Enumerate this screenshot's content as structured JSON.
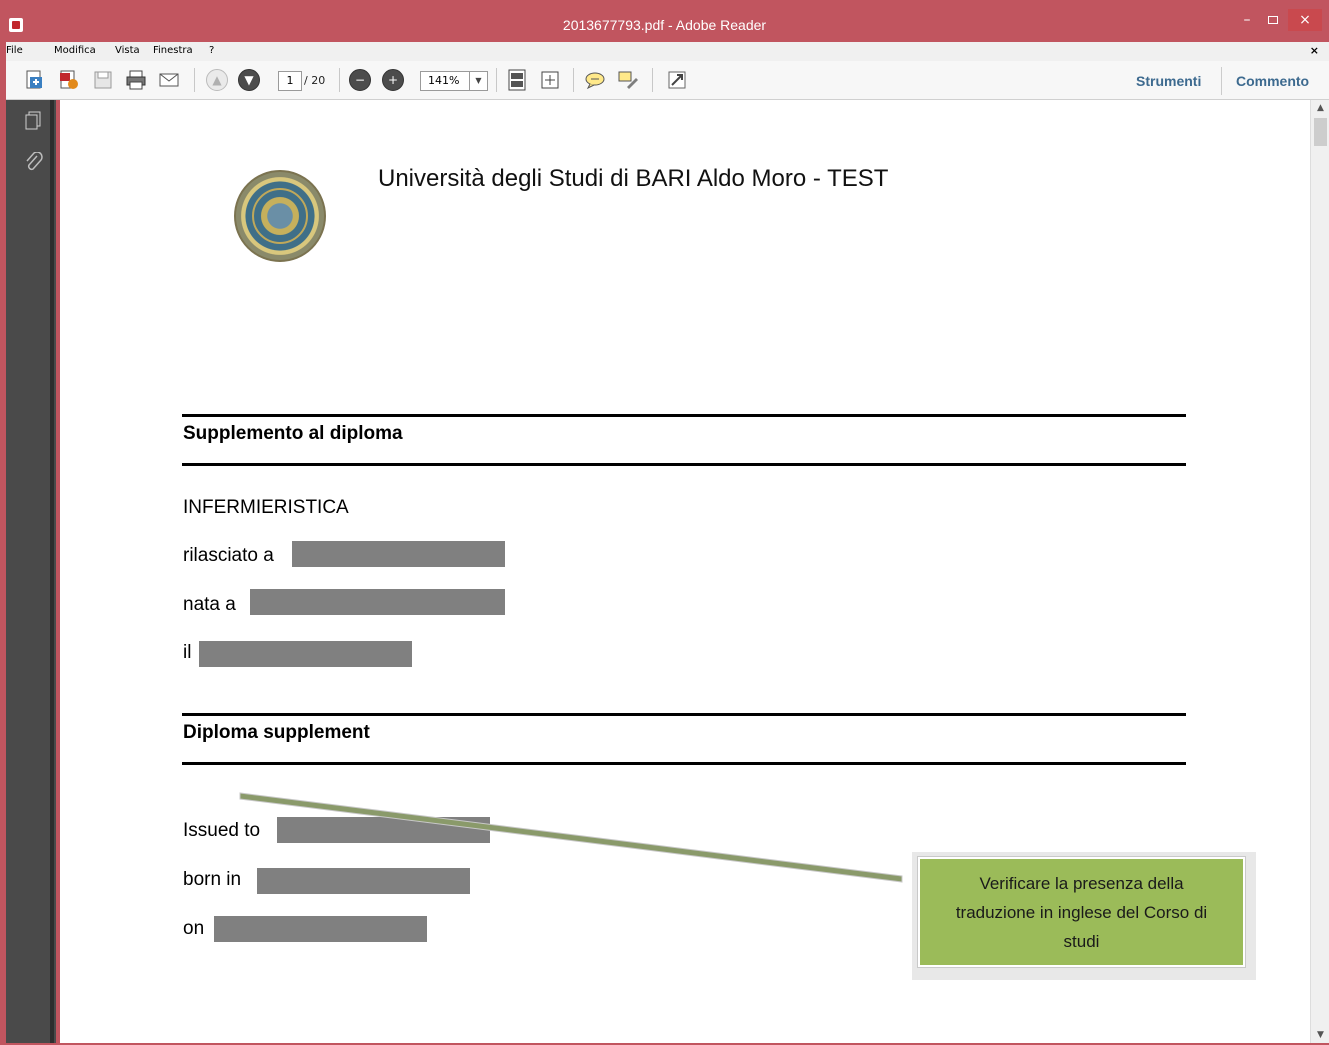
{
  "window": {
    "title": "2013677793.pdf - Adobe Reader",
    "controls": {
      "minimize": "–",
      "close": "×"
    }
  },
  "menu": {
    "items": [
      "File",
      "Modifica",
      "Vista",
      "Finestra",
      "?"
    ],
    "close_label": "×"
  },
  "toolbar": {
    "page_current": "1",
    "page_total": "/ 20",
    "zoom": "141%",
    "tools_label": "Strumenti",
    "comment_label": "Commento"
  },
  "document": {
    "university": "Università degli Studi di BARI Aldo Moro - TEST",
    "section1_title": "Supplemento al diploma",
    "course": "INFERMIERISTICA",
    "issued_it": "rilasciato a",
    "born_it": "nata a",
    "on_it": "il",
    "section2_title": "Diploma supplement",
    "issued_en": "Issued to",
    "born_en": "born in",
    "on_en": "on"
  },
  "annotation": {
    "text_line1": "Verificare la presenza della",
    "text_line2": "traduzione in inglese del Corso di",
    "text_line3": "studi",
    "color": "#9bbb59"
  },
  "icons": [
    "create-pdf-icon",
    "export-icon",
    "save-icon",
    "print-icon",
    "email-icon",
    "prev-page-icon",
    "next-page-icon",
    "zoom-out-icon",
    "zoom-in-icon",
    "fit-page-icon",
    "fit-width-icon",
    "comment-icon",
    "highlight-icon",
    "fullscreen-icon",
    "pages-icon",
    "attachments-icon"
  ]
}
